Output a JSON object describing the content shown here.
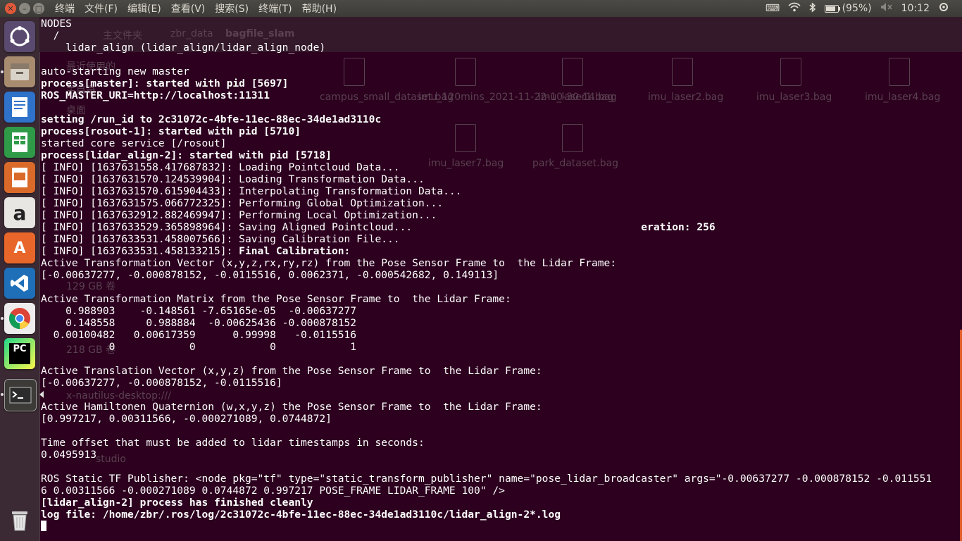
{
  "topbar": {
    "menu": [
      "终端",
      "文件(F)",
      "编辑(E)",
      "查看(V)",
      "搜索(S)",
      "终端(T)",
      "帮助(H)"
    ],
    "battery": "(95%)",
    "clock": "10:12"
  },
  "launcher": {
    "icons": [
      "ubuntu-dash-icon",
      "files-icon",
      "writer-icon",
      "calc-icon",
      "impress-icon",
      "amazon-icon",
      "software-center-icon",
      "vscode-icon",
      "chrome-icon",
      "pycharm-icon",
      "terminal-icon",
      "trash-icon"
    ]
  },
  "background_files": {
    "path": [
      "主文件夹",
      "zbr_data",
      "bagfile_slam"
    ],
    "sidebar": [
      "最近使用的",
      "主目录",
      "桌面",
      "129 GB 卷",
      "218 GB 卷",
      "x-nautilus-desktop:///",
      "studio"
    ],
    "files": [
      "campus_small_dataset.bag",
      "imu_120mins_2021-11-22-10-30-14.bag",
      "imu_laser1.bag",
      "imu_laser2.bag",
      "imu_laser3.bag",
      "imu_laser4.bag",
      "imu_laser7.bag",
      "park_dataset.bag"
    ]
  },
  "terminal": {
    "lines": [
      {
        "t": "NODES",
        "b": false
      },
      {
        "t": "  /",
        "b": false
      },
      {
        "t": "    lidar_align (lidar_align/lidar_align_node)",
        "b": false
      },
      {
        "t": "",
        "b": false
      },
      {
        "t": "auto-starting new master",
        "b": false
      },
      {
        "t": "process[master]: started with pid [5697]",
        "b": true
      },
      {
        "t": "ROS_MASTER_URI=http://localhost:11311",
        "b": true
      },
      {
        "t": "",
        "b": false
      },
      {
        "t": "setting /run_id to 2c31072c-4bfe-11ec-88ec-34de1ad3110c",
        "b": true
      },
      {
        "t": "process[rosout-1]: started with pid [5710]",
        "b": true
      },
      {
        "t": "started core service [/rosout]",
        "b": false
      },
      {
        "t": "process[lidar_align-2]: started with pid [5718]",
        "b": true
      },
      {
        "t": "[ INFO] [1637631558.417687832]: Loading Pointcloud Data...",
        "b": false
      },
      {
        "t": "[ INFO] [1637631570.124539904]: Loading Transformation Data...",
        "b": false
      },
      {
        "t": "[ INFO] [1637631570.615904433]: Interpolating Transformation Data...",
        "b": false
      },
      {
        "t": "[ INFO] [1637631575.066772325]: Performing Global Optimization...",
        "b": false
      },
      {
        "t": "[ INFO] [1637632912.882469947]: Performing Local Optimization...",
        "b": false
      },
      {
        "t": "[ INFO] [1637633529.365898964]: Saving Aligned Pointcloud...",
        "b": false,
        "tail": "eration: 256"
      },
      {
        "t": "[ INFO] [1637633531.458007566]: Saving Calibration File...",
        "b": false
      },
      {
        "t": "[ INFO] [1637633531.458133215]: ",
        "b": false,
        "boldtail": "Final Calibration:"
      },
      {
        "t": "Active Transformation Vector (x,y,z,rx,ry,rz) from the Pose Sensor Frame to  the Lidar Frame:",
        "b": false
      },
      {
        "t": "[-0.00637277, -0.000878152, -0.0115516, 0.0062371, -0.000542682, 0.149113]",
        "b": false
      },
      {
        "t": "",
        "b": false
      },
      {
        "t": "Active Transformation Matrix from the Pose Sensor Frame to  the Lidar Frame:",
        "b": false
      },
      {
        "t": "    0.988903    -0.148561 -7.65165e-05  -0.00637277",
        "b": false
      },
      {
        "t": "    0.148558     0.988884  -0.00625436 -0.000878152",
        "b": false
      },
      {
        "t": "  0.00100482   0.00617359      0.99998   -0.0115516",
        "b": false
      },
      {
        "t": "           0            0            0            1",
        "b": false
      },
      {
        "t": "",
        "b": false
      },
      {
        "t": "Active Translation Vector (x,y,z) from the Pose Sensor Frame to  the Lidar Frame:",
        "b": false
      },
      {
        "t": "[-0.00637277, -0.000878152, -0.0115516]",
        "b": false
      },
      {
        "t": "",
        "b": false
      },
      {
        "t": "Active Hamiltonen Quaternion (w,x,y,z) the Pose Sensor Frame to  the Lidar Frame:",
        "b": false
      },
      {
        "t": "[0.997217, 0.00311566, -0.000271089, 0.0744872]",
        "b": false
      },
      {
        "t": "",
        "b": false
      },
      {
        "t": "Time offset that must be added to lidar timestamps in seconds:",
        "b": false
      },
      {
        "t": "0.0495913",
        "b": false
      },
      {
        "t": "",
        "b": false
      },
      {
        "t": "ROS Static TF Publisher: <node pkg=\"tf\" type=\"static_transform_publisher\" name=\"pose_lidar_broadcaster\" args=\"-0.00637277 -0.000878152 -0.011551",
        "b": false
      },
      {
        "t": "6 0.00311566 -0.000271089 0.0744872 0.997217 POSE_FRAME LIDAR_FRAME 100\" />",
        "b": false
      },
      {
        "t": "[lidar_align-2] process has finished cleanly",
        "b": true
      },
      {
        "t": "log file: /home/zbr/.ros/log/2c31072c-4bfe-11ec-88ec-34de1ad3110c/lidar_align-2*.log",
        "b": true
      }
    ]
  },
  "colors": {
    "terminal_bg": "#2c001e",
    "topbar_bg": "#3c3b37",
    "launcher_bg": "#3b2a33"
  }
}
